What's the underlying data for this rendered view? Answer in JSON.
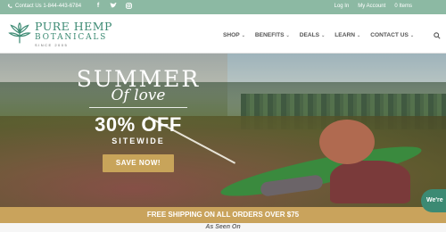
{
  "topbar": {
    "contact": "Contact Us 1-844-443-6784",
    "socials": [
      "f",
      "t",
      "ig"
    ],
    "login": "Log In",
    "account": "My Account",
    "extra": "0 Items"
  },
  "header": {
    "logo_line1": "PURE HEMP",
    "logo_line2": "BOTANICALS",
    "logo_line3": "SINCE 2005",
    "nav": [
      {
        "label": "SHOP"
      },
      {
        "label": "BENEFITS"
      },
      {
        "label": "DEALS"
      },
      {
        "label": "LEARN"
      },
      {
        "label": "CONTACT US"
      }
    ]
  },
  "hero": {
    "summer": "SUMMER",
    "love": "Of love",
    "offer": "30% OFF",
    "sitewide": "SITEWIDE",
    "cta": "SAVE NOW!"
  },
  "shipping": "FREE SHIPPING ON ALL ORDERS OVER $75",
  "as_seen_on": "As Seen On",
  "chat": "We're",
  "colors": {
    "topbar": "#8cb9a3",
    "brand_green": "#3c8a73",
    "gold": "#c9a35c"
  },
  "icons": [
    "phone-icon",
    "facebook-icon",
    "twitter-icon",
    "instagram-icon",
    "search-icon",
    "chevron-down-icon",
    "hemp-leaf-logo"
  ]
}
